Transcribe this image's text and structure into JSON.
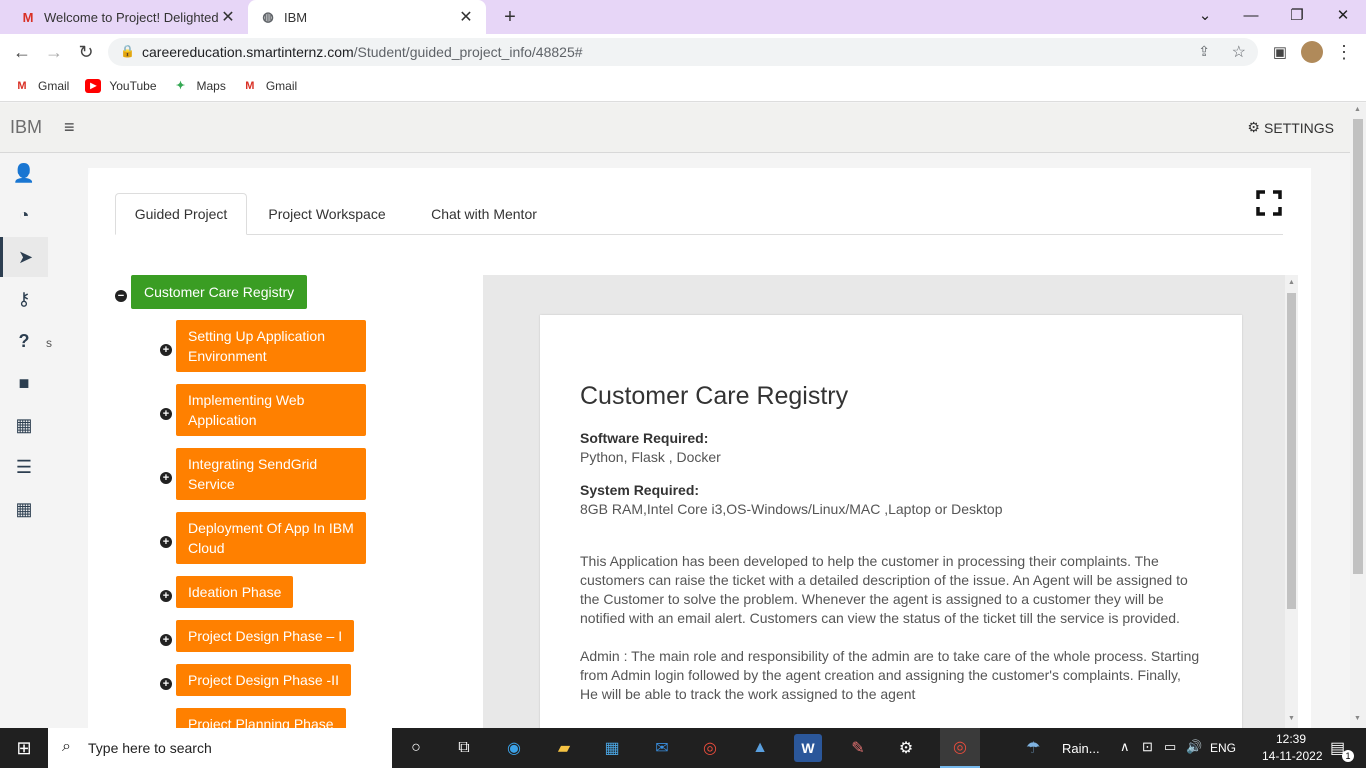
{
  "browser": {
    "tabs": [
      {
        "title": "Welcome to Project! Delighted tc",
        "icon": "gmail-icon"
      },
      {
        "title": "IBM",
        "icon": "globe-icon"
      }
    ],
    "url_host": "careereducation.smartinternz.com",
    "url_path": "/Student/guided_project_info/48825#"
  },
  "bookmarks": [
    "Gmail",
    "YouTube",
    "Maps",
    "Gmail"
  ],
  "app": {
    "brand": "IBM",
    "settings_label": "SETTINGS",
    "sidebar_truncated_text": "s"
  },
  "project_tabs": [
    "Guided Project",
    "Project Workspace",
    "Chat with Mentor"
  ],
  "tree": {
    "root": "Customer Care Registry",
    "children": [
      "Setting Up Application Environment",
      "Implementing Web Application",
      "Integrating SendGrid Service",
      "Deployment Of App In IBM Cloud",
      "Ideation Phase",
      "Project Design Phase – I",
      "Project Design Phase -II",
      "Project Planning Phase"
    ]
  },
  "document": {
    "title": "Customer Care Registry",
    "software_label": "Software Required:",
    "software_value": "Python, Flask , Docker",
    "system_label": "System Required:",
    "system_value": "8GB RAM,Intel Core i3,OS-Windows/Linux/MAC ,Laptop or Desktop",
    "para1": "This Application has been developed to help the customer in processing their complaints.  The customers can raise the ticket with a detailed description of the issue.  An Agent will be assigned to the Customer to solve the problem.  Whenever the agent is assigned to a customer they will be notified with an email alert.  Customers can view the status of the ticket till the service is provided.",
    "para2": "Admin : The main role and responsibility of the admin are to take care of the whole process.  Starting from Admin login followed by the agent creation and assigning the customer's complaints.  Finally, He will be able to track the work assigned to the agent"
  },
  "taskbar": {
    "search_placeholder": "Type here to search",
    "weather": "Rain...",
    "lang": "ENG",
    "time": "12:39",
    "date": "14-11-2022",
    "notification_count": "1"
  },
  "colors": {
    "root_node": "#3a9d23",
    "child_node": "#ff8000",
    "tab_strip": "#e7d6f7"
  }
}
